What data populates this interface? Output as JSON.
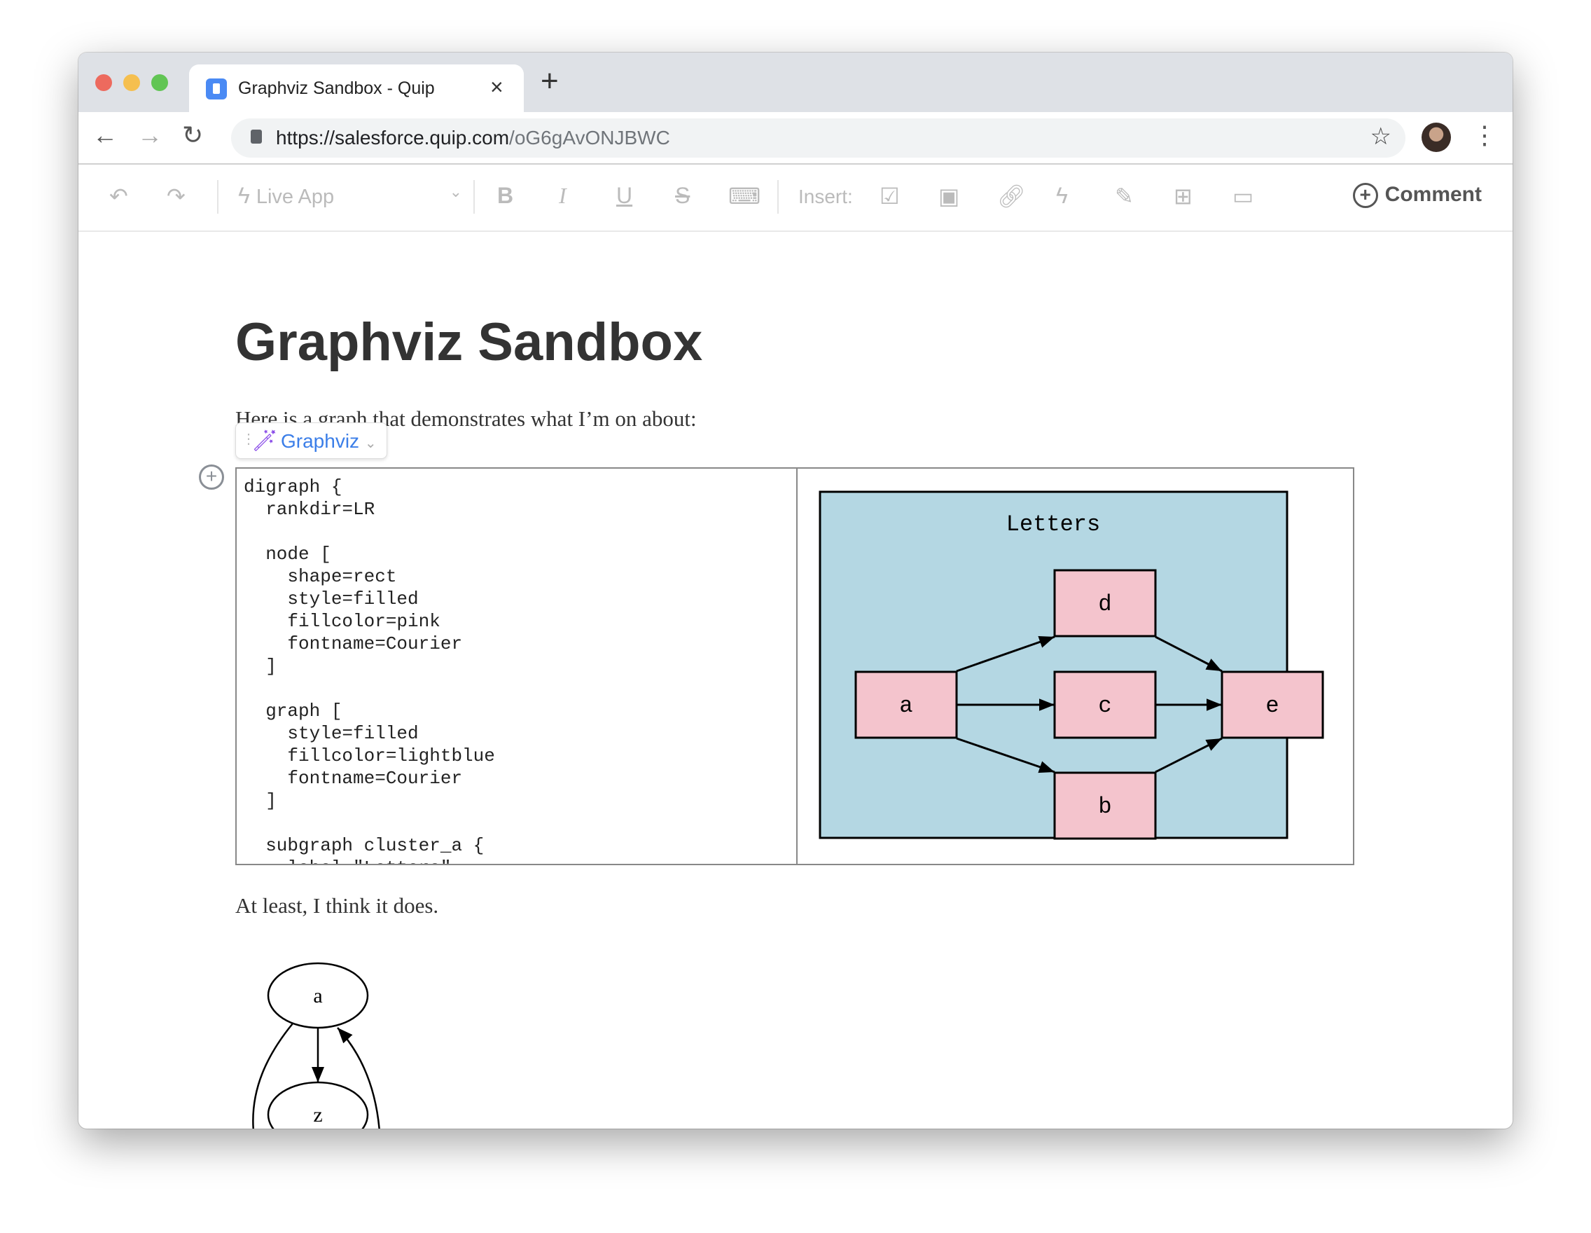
{
  "browser": {
    "tab_title": "Graphviz Sandbox - Quip",
    "url_host": "https://salesforce.quip.com",
    "url_path": "/oG6gAvONJBWC"
  },
  "toolbar": {
    "live_app": "Live App",
    "insert": "Insert:",
    "comment": "Comment"
  },
  "doc": {
    "title": "Graphviz Sandbox",
    "para1": "Here is a graph that demonstrates what I’m on about:",
    "live_app_chip": "Graphviz",
    "code": "digraph {\n  rankdir=LR\n\n  node [\n    shape=rect\n    style=filled\n    fillcolor=pink\n    fontname=Courier\n  ]\n\n  graph [\n    style=filled\n    fillcolor=lightblue\n    fontname=Courier\n  ]\n\n  subgraph cluster_a {\n    label=\"Letters\"",
    "para2": "At least, I think it does."
  },
  "graph1": {
    "cluster_label": "Letters",
    "cluster_fill": "#b4d7e3",
    "node_fill": "#f4c4cd",
    "nodes": [
      "a",
      "b",
      "c",
      "d",
      "e"
    ],
    "edges": [
      [
        "a",
        "d"
      ],
      [
        "a",
        "c"
      ],
      [
        "a",
        "b"
      ],
      [
        "d",
        "e"
      ],
      [
        "c",
        "e"
      ],
      [
        "b",
        "e"
      ]
    ]
  },
  "graph2": {
    "nodes": [
      "a",
      "z"
    ],
    "edges": [
      [
        "a",
        "z"
      ],
      [
        "z",
        "a"
      ]
    ]
  }
}
